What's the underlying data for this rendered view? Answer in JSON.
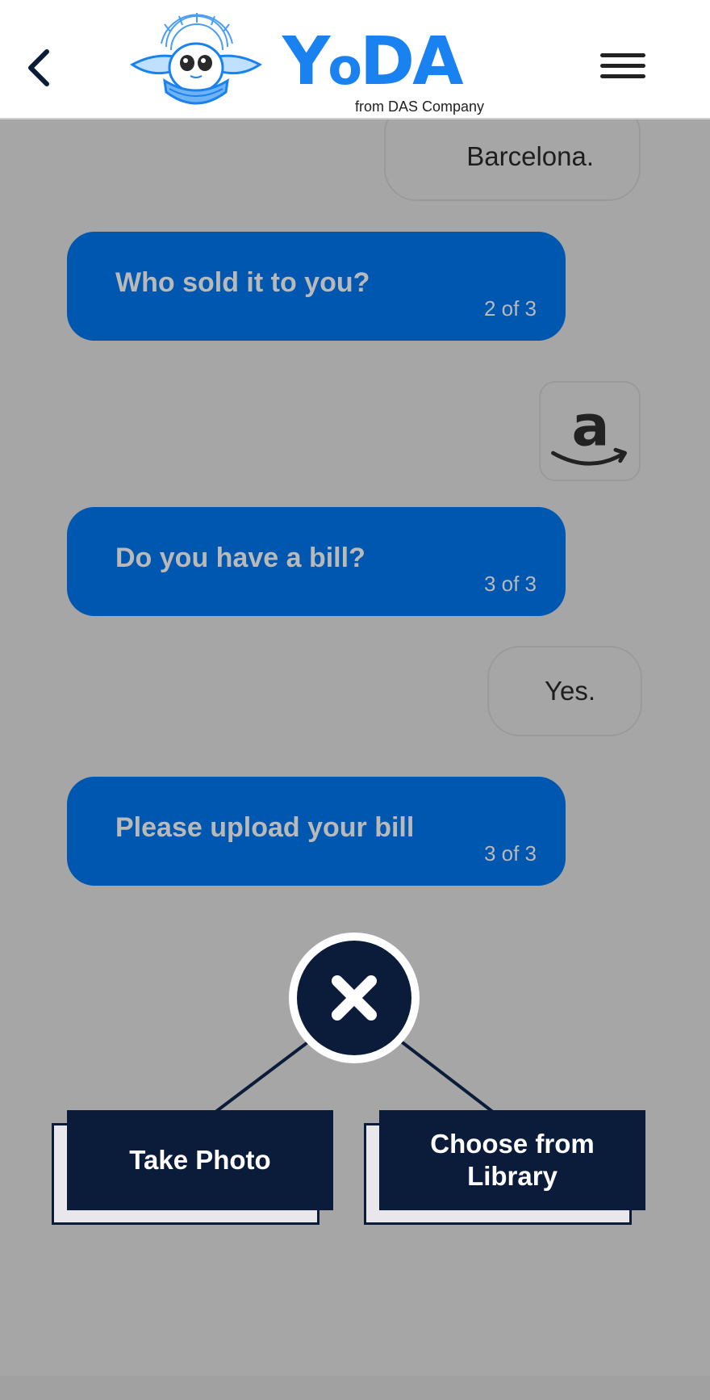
{
  "header": {
    "back_icon": "chevron-left-icon",
    "mascot_icon": "yoda-mascot-icon",
    "logo_text_a": "Y",
    "logo_text_b": "o",
    "logo_text_c": "DA",
    "logo_subtitle": "from DAS Company",
    "menu_icon": "hamburger-menu-icon"
  },
  "chat": {
    "messages": [
      {
        "from": "user",
        "text": "Barcelona."
      },
      {
        "from": "bot",
        "text": "Who sold it to you?",
        "counter": "2 of 3"
      },
      {
        "from": "user",
        "image": "amazon-logo-icon"
      },
      {
        "from": "bot",
        "text": "Do you have a bill?",
        "counter": "3 of 3"
      },
      {
        "from": "user",
        "text": "Yes."
      },
      {
        "from": "bot",
        "text": "Please upload your bill",
        "counter": "3 of 3"
      }
    ]
  },
  "upload": {
    "close_icon": "close-icon",
    "take_photo_label": "Take Photo",
    "choose_library_label": "Choose from Library"
  },
  "colors": {
    "brand_blue": "#1a82f0",
    "bot_bubble": "#0057b0",
    "overlay_bg": "#a6a6a6",
    "navy": "#0b1c3a"
  }
}
